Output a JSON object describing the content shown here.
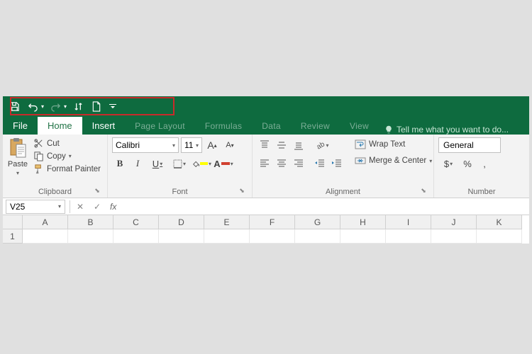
{
  "qat": {
    "items": [
      "save",
      "undo",
      "redo",
      "sort",
      "new",
      "customize"
    ]
  },
  "tabs": {
    "file": "File",
    "home": "Home",
    "insert": "Insert",
    "page_layout": "Page Layout",
    "formulas": "Formulas",
    "data": "Data",
    "review": "Review",
    "view": "View",
    "tellme": "Tell me what you want to do..."
  },
  "ribbon": {
    "clipboard": {
      "label": "Clipboard",
      "paste": "Paste",
      "cut": "Cut",
      "copy": "Copy",
      "format_painter": "Format Painter"
    },
    "font": {
      "label": "Font",
      "name": "Calibri",
      "size": "11",
      "bold": "B",
      "italic": "I",
      "underline": "U"
    },
    "alignment": {
      "label": "Alignment",
      "wrap": "Wrap Text",
      "merge": "Merge & Center"
    },
    "number": {
      "label": "Number",
      "format": "General",
      "currency": "$",
      "percent": "%",
      "comma": ","
    }
  },
  "fx": {
    "name_box": "V25",
    "cancel": "✕",
    "enter": "✓",
    "label": "fx",
    "value": ""
  },
  "grid": {
    "cols": [
      "A",
      "B",
      "C",
      "D",
      "E",
      "F",
      "G",
      "H",
      "I",
      "J",
      "K"
    ],
    "rows": [
      "1"
    ]
  },
  "colors": {
    "brand": "#0e6b3f",
    "highlight_fill": "#ffff00",
    "font_color": "#d04030"
  }
}
